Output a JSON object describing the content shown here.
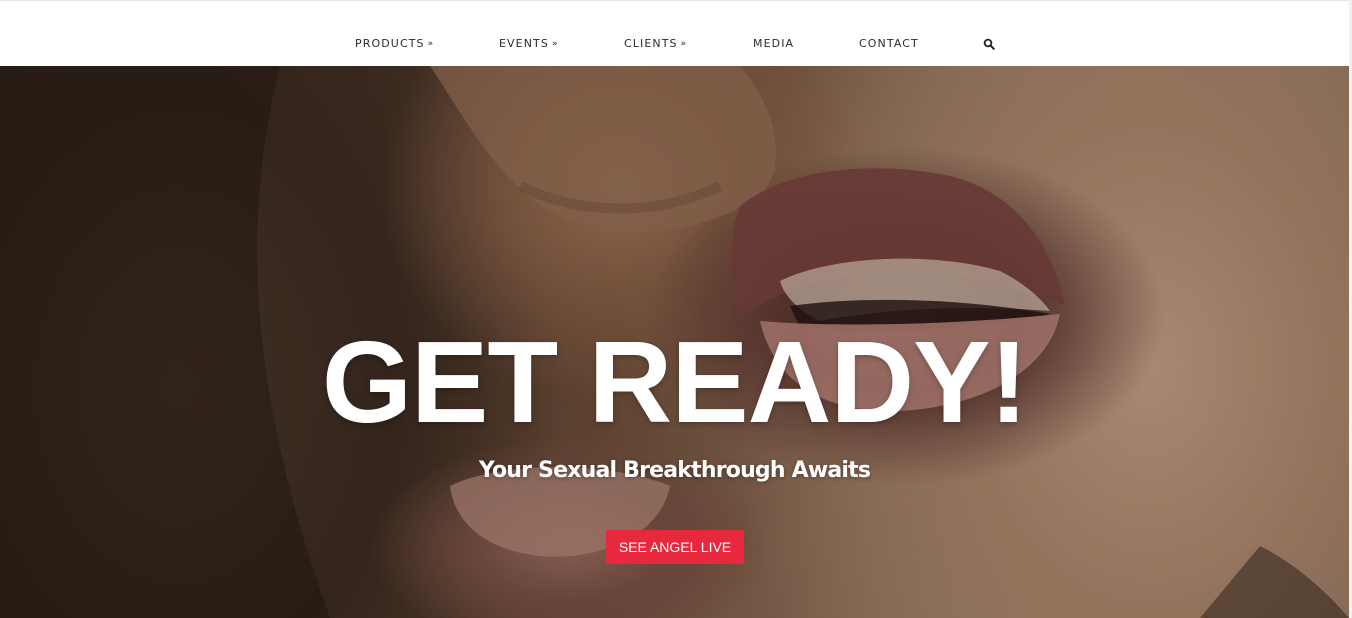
{
  "nav": {
    "items": [
      {
        "label": "PRODUCTS",
        "has_dropdown": true
      },
      {
        "label": "EVENTS",
        "has_dropdown": true
      },
      {
        "label": "CLIENTS",
        "has_dropdown": true
      },
      {
        "label": "MEDIA",
        "has_dropdown": false
      },
      {
        "label": "CONTACT",
        "has_dropdown": false
      }
    ],
    "dropdown_icon": "chevron-double-down-icon",
    "search_icon": "search-icon"
  },
  "hero": {
    "title": "GET READY!",
    "subtitle": "Your Sexual Breakthrough Awaits",
    "cta_label": "SEE ANGEL LIVE",
    "image_description": "close-up photograph of a man and woman about to kiss"
  },
  "colors": {
    "cta_background": "#e8283f",
    "nav_text": "#2b2b2b",
    "hero_text": "#ffffff"
  }
}
